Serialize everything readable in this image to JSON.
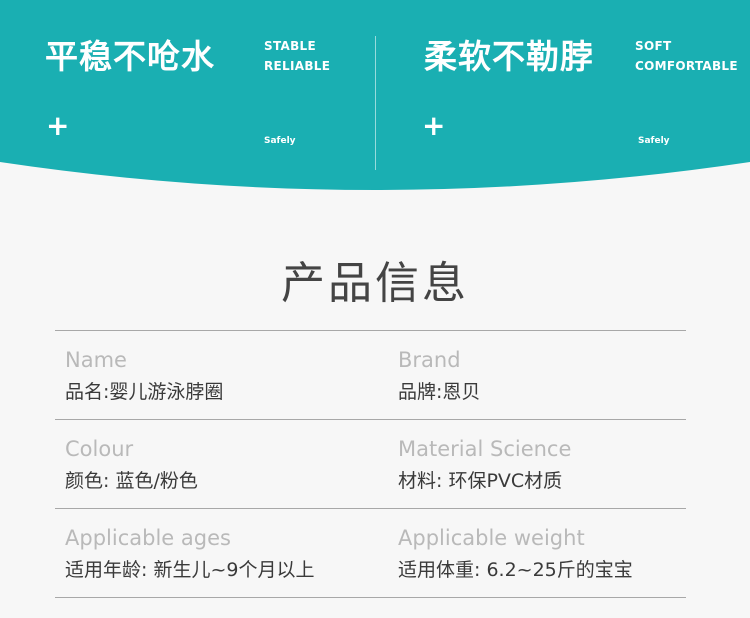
{
  "banner": {
    "color": "#1aafb2",
    "features": [
      {
        "title": "平稳不呛水",
        "sub1": "STABLE",
        "sub2": "RELIABLE",
        "plus": "+",
        "tag": "Safely"
      },
      {
        "title": "柔软不勒脖",
        "sub1": "SOFT",
        "sub2": "COMFORTABLE",
        "plus": "+",
        "tag": "Safely"
      }
    ]
  },
  "section": {
    "title": "产品信息"
  },
  "info": {
    "rows": [
      {
        "left": {
          "en": "Name",
          "zh": "品名:婴儿游泳脖圈"
        },
        "right": {
          "en": "Brand",
          "zh": "品牌:恩贝"
        }
      },
      {
        "left": {
          "en": "Colour",
          "zh": "颜色: 蓝色/粉色"
        },
        "right": {
          "en": "Material Science",
          "zh": "材料: 环保PVC材质"
        }
      },
      {
        "left": {
          "en": "Applicable ages",
          "zh": "适用年龄:  新生儿~9个月以上"
        },
        "right": {
          "en": "Applicable weight",
          "zh": "适用体重:  6.2~25斤的宝宝"
        }
      }
    ]
  }
}
